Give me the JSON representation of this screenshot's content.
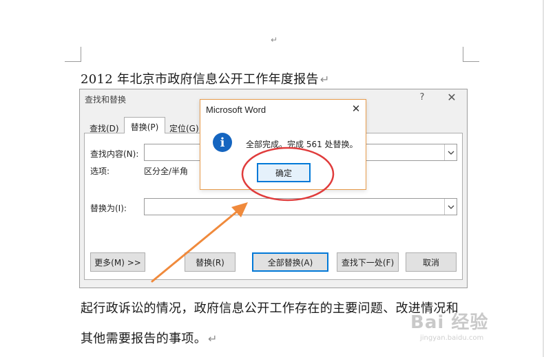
{
  "document": {
    "top_mark": "↵",
    "heading": "2012 年北京市政府信息公开工作年度报告",
    "line1": "起行政诉讼的情况，政府信息公开工作存在的主要问题、改进情况和",
    "line2": "其他需要报告的事项。",
    "paragraph_mark": "↵"
  },
  "find_replace_dialog": {
    "title": "查找和替换",
    "help_label": "?",
    "close_label": "✕",
    "tabs": [
      {
        "label": "查找(D)"
      },
      {
        "label": "替换(P)",
        "active": true
      },
      {
        "label": "定位(G)"
      }
    ],
    "find_label": "查找内容(N):",
    "find_value": "",
    "options_label": "选项:",
    "options_value": "区分全/半角",
    "replace_label": "替换为(I):",
    "replace_value": "",
    "buttons": {
      "more": "更多(M) >>",
      "replace": "替换(R)",
      "replace_all": "全部替换(A)",
      "find_next": "查找下一处(F)",
      "cancel": "取消"
    }
  },
  "message_box": {
    "title": "Microsoft Word",
    "close_label": "✕",
    "icon": "info-icon",
    "message": "全部完成。完成 561 处替换。",
    "ok_label": "确定"
  },
  "annotations": {
    "circle_color": "#e03c3c",
    "arrow_color": "#f08a3c"
  },
  "watermark": {
    "logo": "Bai 经验",
    "url": "jingyan.baidu.com"
  }
}
